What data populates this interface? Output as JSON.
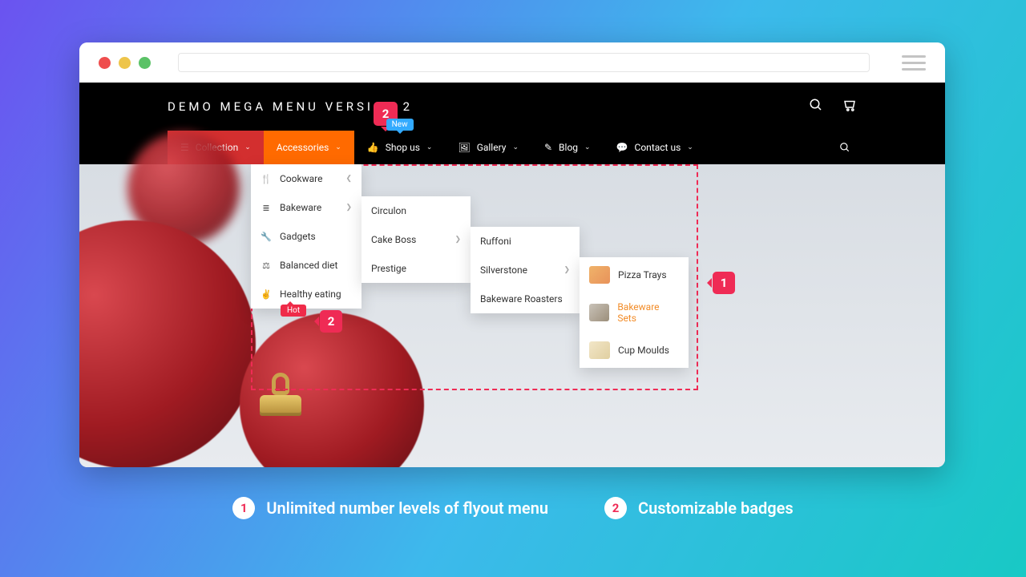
{
  "brand": "DEMO MEGA MENU VERSION 2",
  "nav": {
    "collection": "Collection",
    "accessories": "Accessories",
    "shop": "Shop us",
    "shop_badge": "New",
    "gallery": "Gallery",
    "blog": "Blog",
    "contact": "Contact us"
  },
  "menu1": {
    "cookware": "Cookware",
    "bakeware": "Bakeware",
    "gadgets": "Gadgets",
    "balanced": "Balanced diet",
    "healthy": "Healthy eating",
    "hot_badge": "Hot"
  },
  "menu2": {
    "circulon": "Circulon",
    "cakeboss": "Cake Boss",
    "prestige": "Prestige"
  },
  "menu3": {
    "ruffoni": "Ruffoni",
    "silverstone": "Silverstone",
    "roasters": "Bakeware Roasters"
  },
  "menu4": {
    "pizza": "Pizza Trays",
    "sets": "Bakeware Sets",
    "moulds": "Cup Moulds"
  },
  "callouts": {
    "one": "1",
    "two": "2"
  },
  "legend": {
    "one": "Unlimited number levels of flyout menu",
    "two": "Customizable badges"
  }
}
